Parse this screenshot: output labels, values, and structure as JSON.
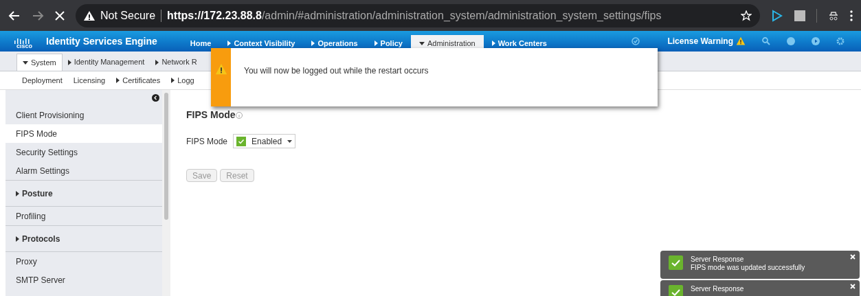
{
  "browser": {
    "security": "Not Secure",
    "url_host": "https://172.23.88.8",
    "url_path": "/admin/#administration/administration_system/administration_system_settings/fips"
  },
  "header": {
    "product": "Identity Services Engine",
    "logo_text": "cisco",
    "license": "License Warning"
  },
  "top_nav": [
    {
      "label": "Home",
      "submenu": false,
      "expanded": false,
      "selected": false
    },
    {
      "label": "Context Visibility",
      "submenu": true,
      "expanded": false,
      "selected": false
    },
    {
      "label": "Operations",
      "submenu": true,
      "expanded": false,
      "selected": false
    },
    {
      "label": "Policy",
      "submenu": true,
      "expanded": false,
      "selected": false
    },
    {
      "label": "Administration",
      "submenu": true,
      "expanded": true,
      "selected": true
    },
    {
      "label": "Work Centers",
      "submenu": true,
      "expanded": false,
      "selected": false
    }
  ],
  "sub_tabs": [
    {
      "label": "System",
      "submenu": true,
      "expanded": true,
      "selected": true
    },
    {
      "label": "Identity Management",
      "submenu": true,
      "expanded": false,
      "selected": false
    },
    {
      "label": "Network R",
      "submenu": true,
      "expanded": false,
      "selected": false
    }
  ],
  "sub_menu": [
    {
      "label": "Deployment",
      "submenu": false
    },
    {
      "label": "Licensing",
      "submenu": false
    },
    {
      "label": "Certificates",
      "submenu": true
    },
    {
      "label": "Logg",
      "submenu": true
    }
  ],
  "sidebar": [
    {
      "label": "Client Provisioning",
      "kind": "link",
      "selected": false
    },
    {
      "label": "FIPS Mode",
      "kind": "link",
      "selected": true
    },
    {
      "label": "Security Settings",
      "kind": "link",
      "selected": false
    },
    {
      "label": "Alarm Settings",
      "kind": "link",
      "selected": false
    },
    {
      "label": "Posture",
      "kind": "group",
      "selected": false
    },
    {
      "label": "Profiling",
      "kind": "link",
      "selected": false
    },
    {
      "label": "Protocols",
      "kind": "group",
      "selected": false
    },
    {
      "label": "Proxy",
      "kind": "link",
      "selected": false
    },
    {
      "label": "SMTP Server",
      "kind": "link",
      "selected": false
    }
  ],
  "content": {
    "title": "FIPS Mode",
    "field_label": "FIPS Mode",
    "field_value": "Enabled",
    "buttons": [
      "Save",
      "Reset"
    ]
  },
  "dialog": {
    "message": "You will now be logged out while the restart occurs"
  },
  "toasts": [
    {
      "title": "Server Response",
      "message": "FIPS mode was updated successfully"
    },
    {
      "title": "Server Response"
    }
  ]
}
